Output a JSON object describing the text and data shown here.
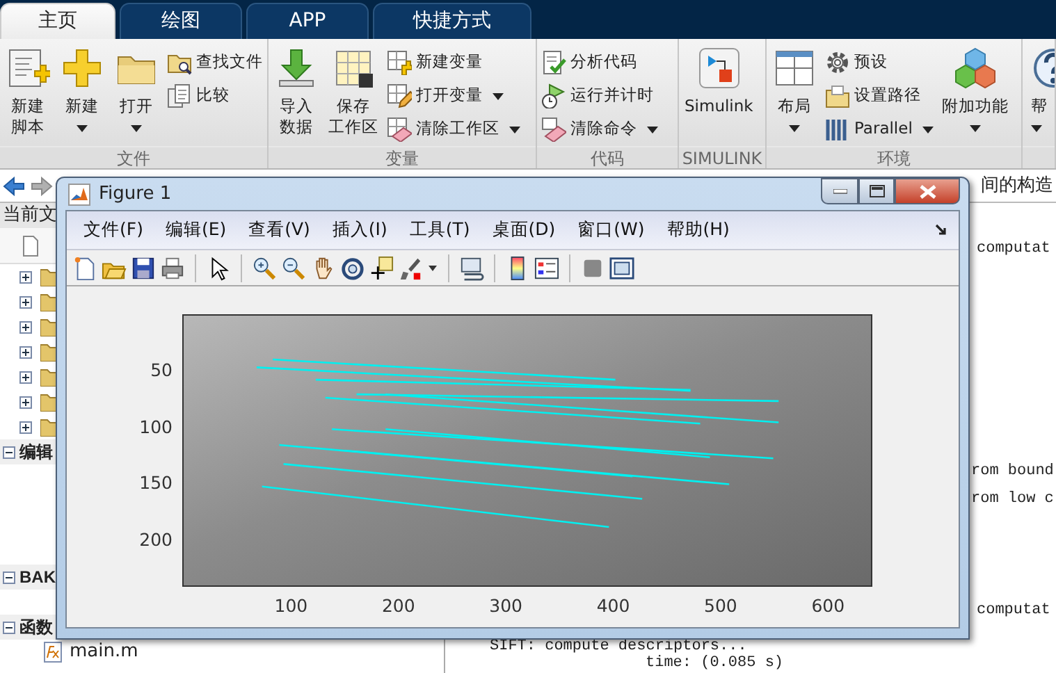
{
  "tabs": [
    {
      "label": "主页",
      "selected": true
    },
    {
      "label": "绘图",
      "selected": false
    },
    {
      "label": "APP",
      "selected": false
    },
    {
      "label": "快捷方式",
      "selected": false
    }
  ],
  "ribbon": {
    "groups": [
      {
        "label": "文件",
        "items": [
          {
            "kind": "large",
            "label": [
              "新建",
              "脚本"
            ],
            "dropdown": false
          },
          {
            "kind": "large",
            "label": [
              "新建"
            ],
            "dropdown": true
          },
          {
            "kind": "large",
            "label": [
              "打开"
            ],
            "dropdown": true
          },
          {
            "kind": "small",
            "label": [
              "查找文件"
            ],
            "dropdown": false
          },
          {
            "kind": "small",
            "label": [
              "比较"
            ],
            "dropdown": false
          }
        ]
      },
      {
        "label": "变量",
        "items": [
          {
            "kind": "large",
            "label": [
              "导入",
              "数据"
            ],
            "dropdown": false
          },
          {
            "kind": "large",
            "label": [
              "保存",
              "工作区"
            ],
            "dropdown": false
          },
          {
            "kind": "small",
            "label": [
              "新建变量"
            ],
            "dropdown": false
          },
          {
            "kind": "small",
            "label": [
              "打开变量"
            ],
            "dropdown": true
          },
          {
            "kind": "small",
            "label": [
              "清除工作区"
            ],
            "dropdown": true
          }
        ]
      },
      {
        "label": "代码",
        "items": [
          {
            "kind": "small",
            "label": [
              "分析代码"
            ],
            "dropdown": false
          },
          {
            "kind": "small",
            "label": [
              "运行并计时"
            ],
            "dropdown": false
          },
          {
            "kind": "small",
            "label": [
              "清除命令"
            ],
            "dropdown": true
          }
        ]
      },
      {
        "label": "SIMULINK",
        "items": [
          {
            "kind": "large",
            "label": [
              "Simulink"
            ],
            "dropdown": false
          }
        ]
      },
      {
        "label": "环境",
        "items": [
          {
            "kind": "large",
            "label": [
              "布局"
            ],
            "dropdown": true
          },
          {
            "kind": "small",
            "label": [
              "预设"
            ],
            "dropdown": false
          },
          {
            "kind": "small",
            "label": [
              "设置路径"
            ],
            "dropdown": false
          },
          {
            "kind": "small",
            "label": [
              "Parallel"
            ],
            "dropdown": true
          },
          {
            "kind": "large",
            "label": [
              "附加功能"
            ],
            "dropdown": true
          }
        ]
      },
      {
        "items": [
          {
            "kind": "large",
            "label": [
              "帮"
            ],
            "dropdown": true
          }
        ]
      }
    ]
  },
  "address_bar": {
    "path_tail": "间的构造"
  },
  "current_folder": {
    "title": "当前文",
    "folders": [
      {
        "expanded": false
      },
      {
        "expanded": false
      },
      {
        "expanded": false
      },
      {
        "expanded": false
      },
      {
        "expanded": false
      },
      {
        "expanded": false
      },
      {
        "expanded": false
      }
    ],
    "sections": [
      {
        "label": "编辑",
        "expanded": true
      },
      {
        "label": "BAK",
        "expanded": true
      },
      {
        "label": "函数",
        "expanded": true,
        "files": [
          "main.m"
        ]
      }
    ]
  },
  "command_window": {
    "lines": [
      "computat",
      "rom bound",
      "rom low c",
      "computat",
      "SIFT: compute descriptors...",
      "time: (0.085 s)"
    ]
  },
  "figure": {
    "title": "Figure 1",
    "menu": [
      "文件(F)",
      "编辑(E)",
      "查看(V)",
      "插入(I)",
      "工具(T)",
      "桌面(D)",
      "窗口(W)",
      "帮助(H)"
    ],
    "axes": {
      "y_ticks": [
        "50",
        "100",
        "150",
        "200"
      ],
      "x_ticks": [
        "100",
        "200",
        "300",
        "400",
        "500",
        "600"
      ]
    }
  }
}
